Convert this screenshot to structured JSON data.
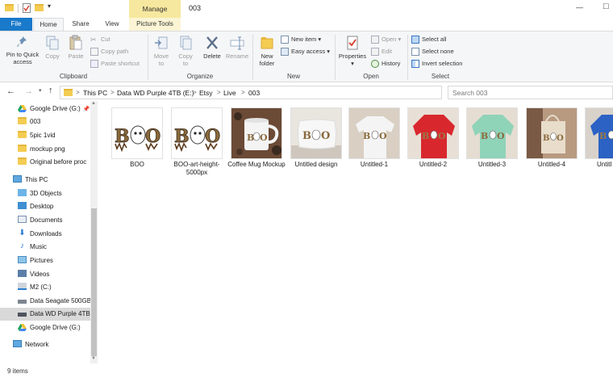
{
  "window": {
    "title": "003",
    "contextual_tab_group": "Manage",
    "maximize_symbol": "□",
    "minimize_symbol": "—",
    "quick_access_arrow": "▾"
  },
  "tabs": [
    {
      "label": "File"
    },
    {
      "label": "Home"
    },
    {
      "label": "Share"
    },
    {
      "label": "View"
    },
    {
      "label": "Picture Tools"
    }
  ],
  "ribbon": {
    "clipboard": {
      "group_label": "Clipboard",
      "pin_line1": "Pin to Quick",
      "pin_line2": "access",
      "copy": "Copy",
      "paste": "Paste",
      "cut": "Cut",
      "copy_path": "Copy path",
      "paste_shortcut": "Paste shortcut"
    },
    "organize": {
      "group_label": "Organize",
      "move_line1": "Move",
      "move_line2": "to",
      "copy_line1": "Copy",
      "copy_line2": "to",
      "delete": "Delete",
      "rename": "Rename"
    },
    "new": {
      "group_label": "New",
      "new_folder_line1": "New",
      "new_folder_line2": "folder",
      "new_item": "New item",
      "easy_access": "Easy access"
    },
    "open": {
      "group_label": "Open",
      "properties": "Properties",
      "open": "Open",
      "edit": "Edit",
      "history": "History"
    },
    "select": {
      "group_label": "Select",
      "select_all": "Select all",
      "select_none": "Select none",
      "invert_selection": "Invert selection"
    }
  },
  "address_bar": {
    "crumbs": [
      "This PC",
      "Data WD Purple 4TB (E:)",
      "Etsy",
      "Live",
      "003"
    ],
    "separator": ">",
    "search_placeholder": "Search 003"
  },
  "sidebar": {
    "items": [
      {
        "label": "Google Drive (G:)",
        "icon": "google-drive-icon",
        "pinned": true
      },
      {
        "label": "003",
        "icon": "folder-icon"
      },
      {
        "label": "5pic 1vid",
        "icon": "folder-icon"
      },
      {
        "label": "mockup png",
        "icon": "folder-icon"
      },
      {
        "label": "Original before proc",
        "icon": "folder-icon"
      },
      {
        "label": "This PC",
        "icon": "computer-icon"
      },
      {
        "label": "3D Objects",
        "icon": "3d-objects-icon"
      },
      {
        "label": "Desktop",
        "icon": "desktop-icon"
      },
      {
        "label": "Documents",
        "icon": "documents-icon"
      },
      {
        "label": "Downloads",
        "icon": "downloads-icon"
      },
      {
        "label": "Music",
        "icon": "music-icon"
      },
      {
        "label": "Pictures",
        "icon": "pictures-icon"
      },
      {
        "label": "Videos",
        "icon": "videos-icon"
      },
      {
        "label": "M2 (C:)",
        "icon": "windows-drive-icon"
      },
      {
        "label": "Data Seagate 500GB",
        "icon": "drive-icon"
      },
      {
        "label": "Data WD Purple 4TB",
        "icon": "drive-icon",
        "selected": true
      },
      {
        "label": "Google Drive (G:)",
        "icon": "google-drive-icon"
      },
      {
        "label": "Network",
        "icon": "network-icon"
      }
    ]
  },
  "files": [
    {
      "name": "BOO",
      "kind": "boo-art",
      "accent": "#ffffff"
    },
    {
      "name": "BOO-art-height-5000px",
      "kind": "boo-art",
      "accent": "#ffffff"
    },
    {
      "name": "Coffee Mug Mockup",
      "kind": "mug",
      "accent": "#6b4a36"
    },
    {
      "name": "Untitled design",
      "kind": "pillow",
      "accent": "#f2f2f2"
    },
    {
      "name": "Untitled-1",
      "kind": "shirt",
      "accent": "#f4f4f4"
    },
    {
      "name": "Untitled-2",
      "kind": "shirt",
      "accent": "#d8282e"
    },
    {
      "name": "Untitled-3",
      "kind": "shirt",
      "accent": "#8fd3b8"
    },
    {
      "name": "Untitled-4",
      "kind": "tote",
      "accent": "#e8dccb"
    },
    {
      "name": "Untitl",
      "kind": "shirt",
      "accent": "#2b62c4"
    }
  ],
  "status": {
    "item_count": "9 items"
  },
  "colors": {
    "file_tab": "#1979ca",
    "manage_context": "#f6e89e",
    "selection_highlight": "#cce8ff",
    "sidebar_selected": "#d9d9d9"
  }
}
